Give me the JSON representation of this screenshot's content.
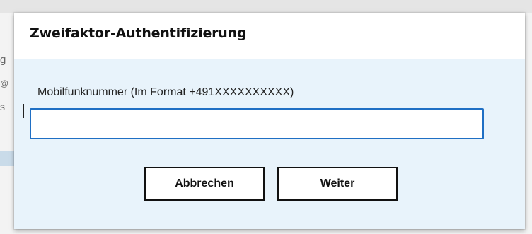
{
  "background": {
    "fragments": [
      "g",
      "@",
      "s"
    ]
  },
  "dialog": {
    "title": "Zweifaktor-Authentifizierung",
    "phone_field": {
      "label": "Mobilfunknummer (Im Format +491XXXXXXXXXX)",
      "value": "",
      "placeholder": ""
    },
    "buttons": {
      "cancel_label": "Abbrechen",
      "next_label": "Weiter"
    }
  },
  "colors": {
    "dialog_background": "#e8f3fb",
    "input_focus_border": "#1f6fc4",
    "button_border": "#111111"
  }
}
